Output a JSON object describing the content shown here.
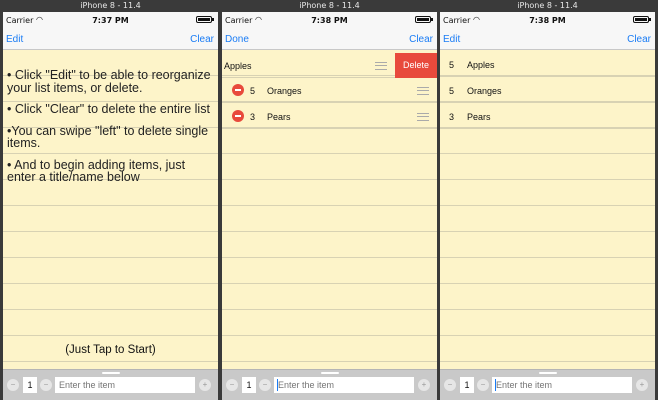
{
  "simulators": [
    {
      "title": "iPhone 8 - 11.4",
      "status": {
        "carrier": "Carrier",
        "time": "7:37 PM"
      },
      "nav": {
        "left": "Edit",
        "right": "Clear"
      },
      "instructions": [
        "• Click \"Edit\" to be able to reorganize your list items, or delete.",
        "• Click \"Clear\" to delete the entire list",
        "•You can swipe \"left\" to delete single items.",
        "• And to begin adding items, just enter a title/name below"
      ],
      "tap_hint": "(Just Tap to Start)",
      "bottom": {
        "qty": "1",
        "placeholder": "Enter the item"
      }
    },
    {
      "title": "iPhone 8 - 11.4",
      "status": {
        "carrier": "Carrier",
        "time": "7:38 PM"
      },
      "nav": {
        "left": "Done",
        "right": "Clear"
      },
      "swiped_item": {
        "name": "Apples",
        "delete_label": "Delete"
      },
      "items": [
        {
          "qty": "5",
          "name": "Oranges"
        },
        {
          "qty": "3",
          "name": "Pears"
        }
      ],
      "bottom": {
        "qty": "1",
        "placeholder": "Enter the item"
      }
    },
    {
      "title": "iPhone 8 - 11.4",
      "status": {
        "carrier": "Carrier",
        "time": "7:38 PM"
      },
      "nav": {
        "left": "Edit",
        "right": "Clear"
      },
      "items": [
        {
          "qty": "5",
          "name": "Apples"
        },
        {
          "qty": "5",
          "name": "Oranges"
        },
        {
          "qty": "3",
          "name": "Pears"
        }
      ],
      "bottom": {
        "qty": "1",
        "placeholder": "Enter the item"
      }
    }
  ],
  "icons": {
    "minus": "minus-circle-icon",
    "plus": "plus-circle-icon",
    "wifi": "wifi-icon",
    "battery": "battery-icon",
    "reorder": "reorder-icon"
  },
  "colors": {
    "paper": "#fdf4c9",
    "accent": "#1a7cf5",
    "delete": "#e84a3c"
  }
}
